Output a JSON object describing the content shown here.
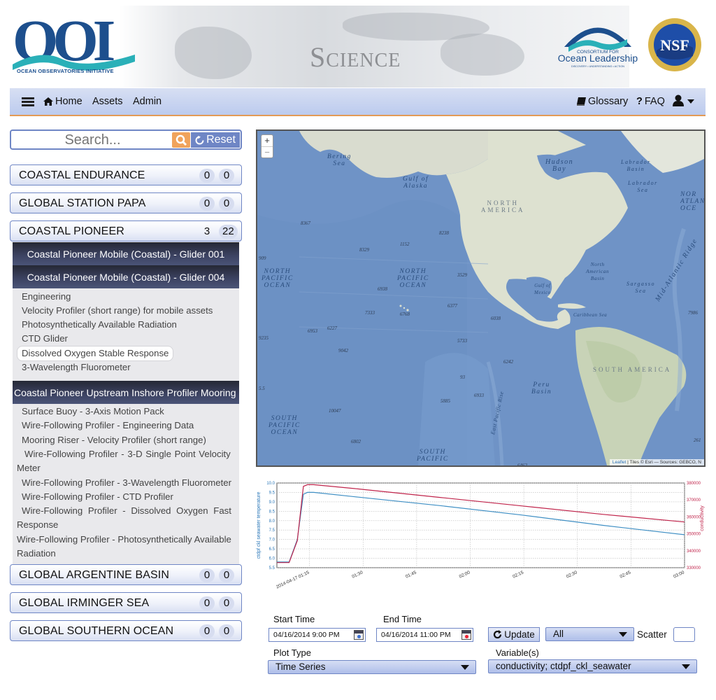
{
  "banner": {
    "logo_text": "OOI",
    "logo_subtitle": "OCEAN OBSERVATORIES INITIATIVE",
    "section_title_first": "S",
    "section_title_rest": "CIENCE",
    "consortium_top": "CONSORTIUM FOR",
    "consortium_name": "Ocean Leadership",
    "consortium_tagline": "DISCOVERY • UNDERSTANDING • ACTION",
    "nsf_text": "NSF"
  },
  "nav": {
    "home": "Home",
    "assets": "Assets",
    "admin": "Admin",
    "glossary": "Glossary",
    "faq_mark": "?",
    "faq": "FAQ"
  },
  "search": {
    "placeholder": "Search...",
    "reset_label": "Reset"
  },
  "arrays": [
    {
      "name": "COASTAL ENDURANCE",
      "count_a": "0",
      "count_b": "0"
    },
    {
      "name": "GLOBAL STATION PAPA",
      "count_a": "0",
      "count_b": "0"
    },
    {
      "name": "COASTAL PIONEER",
      "count_a": "3",
      "count_b": "22"
    },
    {
      "name": "GLOBAL ARGENTINE BASIN",
      "count_a": "0",
      "count_b": "0"
    },
    {
      "name": "GLOBAL IRMINGER SEA",
      "count_a": "0",
      "count_b": "0"
    },
    {
      "name": "GLOBAL SOUTHERN OCEAN",
      "count_a": "0",
      "count_b": "0"
    }
  ],
  "platforms": [
    {
      "name": "Coastal Pioneer Mobile (Coastal) - Glider 001"
    },
    {
      "name": "Coastal Pioneer Mobile (Coastal) - Glider 004"
    },
    {
      "name": "Coastal Pioneer Upstream Inshore Profiler Mooring"
    }
  ],
  "glider004_instruments": [
    "Engineering",
    "Velocity Profiler (short range) for mobile assets",
    "Photosynthetically Available Radiation",
    "CTD Glider",
    "Dissolved Oxygen Stable Response",
    "3-Wavelength Fluorometer"
  ],
  "mooring_instruments": [
    {
      "line1": "Surface Buoy - 3-Axis Motion Pack",
      "line2": ""
    },
    {
      "line1": "Wire-Following Profiler - Engineering Data",
      "line2": ""
    },
    {
      "line1": "Mooring Riser - Velocity Profiler (short range)",
      "line2": ""
    },
    {
      "line1": "Wire-Following Profiler - 3-D Single Point Velocity",
      "line2": "Meter"
    },
    {
      "line1": "Wire-Following Profiler - 3-Wavelength Fluorometer",
      "line2": ""
    },
    {
      "line1": "Wire-Following Profiler - CTD Profiler",
      "line2": ""
    },
    {
      "line1": "Wire-Following Profiler - Dissolved Oxygen Fast",
      "line2": "Response"
    },
    {
      "line1": "Wire-Following Profiler - Photosynthetically Available",
      "line2": "Radiation"
    }
  ],
  "map": {
    "zoom_in": "+",
    "zoom_out": "−",
    "attribution_leaflet": "Leaflet",
    "attribution_rest": " | Tiles © Esri — Sources: GEBCO, N",
    "labels": {
      "bering": "Bering\nSea",
      "alaska": "Gulf of\nAlaska",
      "hudson": "Hudson\nBay",
      "labrador_basin": "Labrador\nBasin",
      "labrador_sea": "Labrador\nSea",
      "north_atlantic": "NOR\nATLAN\nOCE",
      "north_america": "NORTH\nAMERICA",
      "north_pacific_left": "NORTH\nPACIFIC\nOCEAN",
      "north_pacific_mid": "NORTH\nPACIFIC\nOCEAN",
      "north_american_basin": "North\nAmerican\nBasin",
      "sargasso": "Sargasso\nSea",
      "mid_atlantic": "Mid-Atlantic Ridge",
      "gulf_mexico": "Gulf of\nMexico",
      "caribbean": "Caribbean Sea",
      "south_america": "SOUTH AMERICA",
      "peru": "Peru\nBasin",
      "south_pacific_left": "SOUTH\nPACIFIC\nOCEAN",
      "south_pacific_bottom": "SOUTH\nPACIFIC",
      "east_pacific_rise": "East Pacific Rise"
    },
    "depths": [
      "8367",
      "8238",
      "1152",
      "8329",
      "3529",
      "6938",
      "6377",
      "7333",
      "6768",
      "6038",
      "6227",
      "6953",
      "5733",
      "9042",
      "6242",
      "93",
      "6933",
      "5885",
      "10047",
      "6802",
      "6462",
      "7986",
      "9235",
      "909",
      "5.5",
      "261"
    ]
  },
  "chart_data": {
    "type": "line",
    "title": "",
    "xlabel": "",
    "ylabel": "ctdpf ckl seawater temperature",
    "y2label": "conductivity",
    "x_ticks": [
      "2014-04-17 01:15",
      "01:30",
      "01:45",
      "02:00",
      "02:15",
      "02:30",
      "02:45",
      "03:00"
    ],
    "ylim": [
      5.5,
      10.0
    ],
    "y_ticks": [
      "10.0",
      "9.5",
      "9.0",
      "8.5",
      "8.0",
      "7.5",
      "7.0",
      "6.5",
      "6.0",
      "5.5"
    ],
    "y2lim": [
      330000,
      380000
    ],
    "y2_ticks": [
      "380000",
      "370000",
      "360000",
      "350000",
      "340000",
      "330000"
    ],
    "grid": true,
    "series": [
      {
        "name": "ctdpf ckl seawater temperature",
        "axis": "left",
        "color": "#3f8fc4",
        "x": [
          0,
          0.03,
          0.05,
          0.065,
          0.075,
          0.09,
          0.2,
          0.4,
          0.6,
          0.8,
          1.0
        ],
        "y": [
          5.8,
          5.8,
          7.0,
          9.4,
          9.5,
          9.5,
          9.25,
          8.8,
          8.3,
          7.75,
          7.25
        ]
      },
      {
        "name": "conductivity",
        "axis": "right",
        "color": "#c0244b",
        "x": [
          0,
          0.03,
          0.05,
          0.065,
          0.075,
          0.09,
          0.2,
          0.4,
          0.6,
          0.8,
          1.0
        ],
        "y": [
          333000,
          333000,
          346000,
          378000,
          379000,
          379000,
          376500,
          371500,
          366500,
          361500,
          357000
        ]
      }
    ]
  },
  "controls": {
    "start_label": "Start Time",
    "start_value": "04/16/2014 9:00 PM",
    "end_label": "End Time",
    "end_value": "04/16/2014 11:00 PM",
    "update_label": "Update",
    "all_select": "All",
    "scatter_label": "Scatter",
    "plot_type_label": "Plot Type",
    "plot_type_value": "Time Series",
    "variables_label": "Variable(s)",
    "variables_value": "conductivity; ctdpf_ckl_seawater"
  },
  "colors": {
    "accent": "#6f86c5",
    "nav_underline": "#e39a55",
    "panel_dark": "#2c3147"
  }
}
